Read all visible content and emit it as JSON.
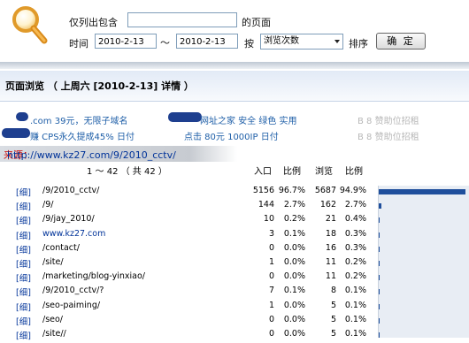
{
  "filter": {
    "label_only_contains": "仅列出包含",
    "keyword_value": "",
    "label_page": "的页面",
    "label_time": "时间",
    "date_from": "2010-2-13",
    "range_sep": "～",
    "date_to": "2010-2-13",
    "label_by": "按",
    "sort_value": "浏览次数",
    "label_sort": "排序",
    "confirm_label": "确 定"
  },
  "page": {
    "title": "页面浏览 （ 上周六 [2010-2-13] 详情 ）"
  },
  "ads": {
    "row1_left": ".com 39元，无限子域名",
    "row1_mid": "网址之家 安全 绿色 实用",
    "row1_right": "B 8 赞助位招租",
    "row2_left": "赚 CPS永久提成45% 日付",
    "row2_mid": "点击 80元 1000IP 日付",
    "row2_right": "B 8 赞助位招租"
  },
  "source": {
    "label": "来源：",
    "url": "http://www.kz27.com/9/2010_cctv/"
  },
  "table": {
    "range": "1 ～ 42 （ 共 42 ）",
    "headers": [
      "入口",
      "比例",
      "浏览",
      "比例"
    ],
    "rows": [
      {
        "tag": "[细]",
        "path": "/9/2010_cctv/",
        "entry": "5156",
        "entry_pct": "96.7%",
        "views": "5687",
        "views_pct": "94.9%",
        "share": 0.949
      },
      {
        "tag": "[细]",
        "path": "/9/",
        "entry": "144",
        "entry_pct": "2.7%",
        "views": "162",
        "views_pct": "2.7%",
        "share": 0.027
      },
      {
        "tag": "[细]",
        "path": "/9/jay_2010/",
        "entry": "10",
        "entry_pct": "0.2%",
        "views": "21",
        "views_pct": "0.4%",
        "share": 0.004
      },
      {
        "tag": "[细]",
        "path": "www.kz27.com",
        "entry": "3",
        "entry_pct": "0.1%",
        "views": "18",
        "views_pct": "0.3%",
        "share": 0.003,
        "link": true
      },
      {
        "tag": "[细]",
        "path": "/contact/",
        "entry": "0",
        "entry_pct": "0.0%",
        "views": "16",
        "views_pct": "0.3%",
        "share": 0.003
      },
      {
        "tag": "[细]",
        "path": "/site/",
        "entry": "1",
        "entry_pct": "0.0%",
        "views": "11",
        "views_pct": "0.2%",
        "share": 0.002
      },
      {
        "tag": "[细]",
        "path": "/marketing/blog-yinxiao/",
        "entry": "0",
        "entry_pct": "0.0%",
        "views": "11",
        "views_pct": "0.2%",
        "share": 0.002
      },
      {
        "tag": "[细]",
        "path": "/9/2010_cctv/?",
        "entry": "7",
        "entry_pct": "0.1%",
        "views": "8",
        "views_pct": "0.1%",
        "share": 0.001
      },
      {
        "tag": "[细]",
        "path": "/seo-paiming/",
        "entry": "1",
        "entry_pct": "0.0%",
        "views": "5",
        "views_pct": "0.1%",
        "share": 0.001
      },
      {
        "tag": "[细]",
        "path": "/seo/",
        "entry": "0",
        "entry_pct": "0.0%",
        "views": "5",
        "views_pct": "0.1%",
        "share": 0.001
      },
      {
        "tag": "[细]",
        "path": "/site//",
        "entry": "0",
        "entry_pct": "0.0%",
        "views": "5",
        "views_pct": "0.1%",
        "share": 0.001
      }
    ]
  },
  "colors": {
    "link": "#003399",
    "source_label": "#cc0000",
    "bar": "#1f4f9c",
    "ad_blob": "#1e3f8f"
  },
  "icons": {
    "search": "magnifier-icon"
  }
}
